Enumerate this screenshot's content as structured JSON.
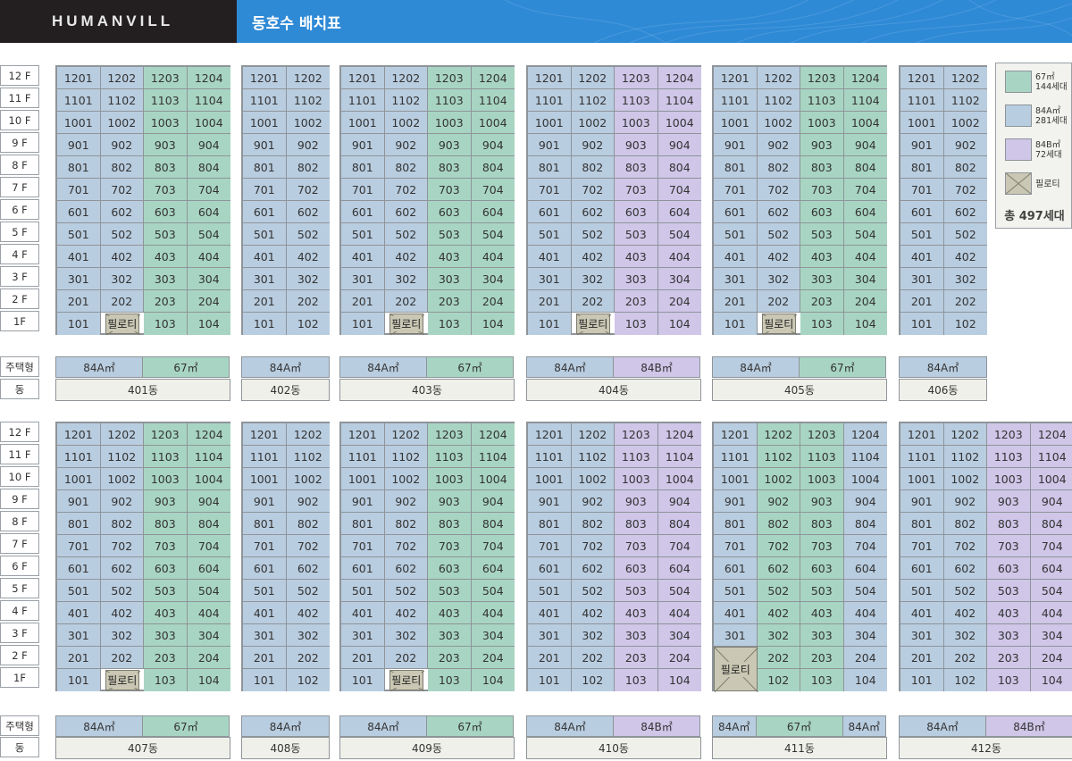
{
  "header": {
    "brand": "HUMANVILL",
    "title": "동호수 배치표"
  },
  "floor_labels": [
    "12 F",
    "11 F",
    "10 F",
    "9 F",
    "8 F",
    "7 F",
    "6 F",
    "5 F",
    "4 F",
    "3 F",
    "2 F",
    "1F"
  ],
  "row_labels": {
    "type": "주택형",
    "dong": "동"
  },
  "pilotis_label": "필로티",
  "colors": {
    "A": "#b9cde0",
    "G": "#a8d5c3",
    "P": "#cfc6e8",
    "pilotis": "#cac8b4",
    "header_blue": "#2f8ad6"
  },
  "legend": {
    "items": [
      {
        "color": "G",
        "line1": "67㎡",
        "line2": "144세대"
      },
      {
        "color": "A",
        "line1": "84A㎡",
        "line2": "281세대"
      },
      {
        "color": "P",
        "line1": "84B㎡",
        "line2": "72세대"
      },
      {
        "color": "X",
        "line1": "필로티",
        "line2": ""
      }
    ],
    "total": "총 497세대"
  },
  "type_names": {
    "A": "84A㎡",
    "G": "67㎡",
    "P": "84B㎡"
  },
  "buildings": [
    {
      "dong": "401동",
      "lines": [
        "A",
        "A",
        "G",
        "G"
      ],
      "pilotis": [
        1
      ],
      "types": [
        [
          "A",
          2
        ],
        [
          "G",
          2
        ]
      ]
    },
    {
      "dong": "402동",
      "lines": [
        "A",
        "A"
      ],
      "pilotis": [],
      "types": [
        [
          "A",
          2
        ]
      ]
    },
    {
      "dong": "403동",
      "lines": [
        "A",
        "A",
        "G",
        "G"
      ],
      "pilotis": [
        1
      ],
      "types": [
        [
          "A",
          2
        ],
        [
          "G",
          2
        ]
      ]
    },
    {
      "dong": "404동",
      "lines": [
        "A",
        "A",
        "P",
        "P"
      ],
      "pilotis": [
        1
      ],
      "types": [
        [
          "A",
          2
        ],
        [
          "P",
          2
        ]
      ]
    },
    {
      "dong": "405동",
      "lines": [
        "A",
        "A",
        "G",
        "G"
      ],
      "pilotis": [
        1
      ],
      "types": [
        [
          "A",
          2
        ],
        [
          "G",
          2
        ]
      ]
    },
    {
      "dong": "406동",
      "lines": [
        "A",
        "A"
      ],
      "pilotis": [],
      "types": [
        [
          "A",
          2
        ]
      ]
    },
    {
      "dong": "407동",
      "lines": [
        "A",
        "A",
        "G",
        "G"
      ],
      "pilotis": [
        1
      ],
      "types": [
        [
          "A",
          2
        ],
        [
          "G",
          2
        ]
      ]
    },
    {
      "dong": "408동",
      "lines": [
        "A",
        "A"
      ],
      "pilotis": [],
      "types": [
        [
          "A",
          2
        ]
      ]
    },
    {
      "dong": "409동",
      "lines": [
        "A",
        "A",
        "G",
        "G"
      ],
      "pilotis": [
        1
      ],
      "types": [
        [
          "A",
          2
        ],
        [
          "G",
          2
        ]
      ]
    },
    {
      "dong": "410동",
      "lines": [
        "A",
        "A",
        "P",
        "P"
      ],
      "pilotis": [],
      "types": [
        [
          "A",
          2
        ],
        [
          "P",
          2
        ]
      ]
    },
    {
      "dong": "411동",
      "lines": [
        "A",
        "G",
        "G",
        "A"
      ],
      "pilotis": [
        0
      ],
      "pilotis_span2": true,
      "types": [
        [
          "A",
          1
        ],
        [
          "G",
          2
        ],
        [
          "A",
          1
        ]
      ]
    },
    {
      "dong": "412동",
      "lines": [
        "A",
        "A",
        "P",
        "P"
      ],
      "pilotis": [],
      "types": [
        [
          "A",
          2
        ],
        [
          "P",
          2
        ]
      ]
    }
  ]
}
